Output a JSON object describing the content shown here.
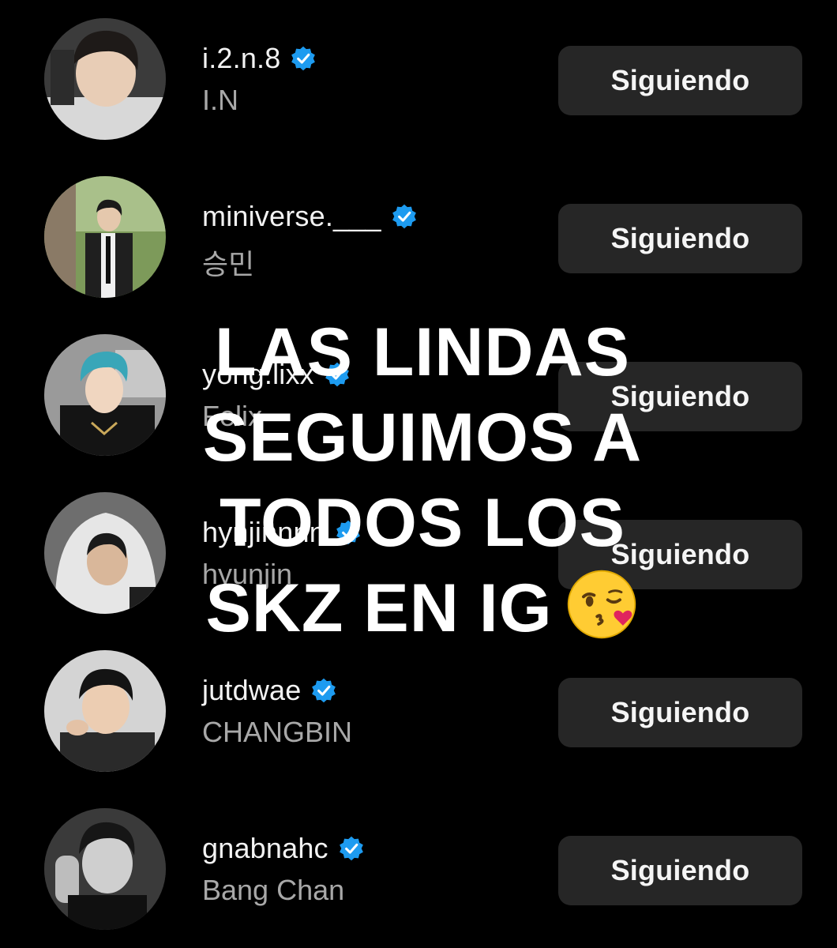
{
  "accounts": [
    {
      "username": "i.2.n.8",
      "fullname": "I.N",
      "verified": true,
      "button_label": "Siguiendo"
    },
    {
      "username": "miniverse.___",
      "fullname": "승민",
      "verified": true,
      "button_label": "Siguiendo"
    },
    {
      "username": "yong.lixx",
      "fullname": "Felix",
      "verified": true,
      "button_label": "Siguiendo"
    },
    {
      "username": "hynjinnnn",
      "fullname": "hyunjin",
      "verified": true,
      "button_label": "Siguiendo"
    },
    {
      "username": "jutdwae",
      "fullname": "CHANGBIN",
      "verified": true,
      "button_label": "Siguiendo"
    },
    {
      "username": "gnabnahc",
      "fullname": "Bang Chan",
      "verified": true,
      "button_label": "Siguiendo"
    }
  ],
  "overlay": {
    "lines": [
      "LAS LINDAS",
      "SEGUIMOS A",
      "TODOS LOS",
      "SKZ EN IG"
    ],
    "emoji": "kissing-face-wink-heart"
  },
  "colors": {
    "background": "#000000",
    "button_bg": "#262626",
    "verified": "#1d9bf0",
    "fullname": "#a8a8a8"
  }
}
